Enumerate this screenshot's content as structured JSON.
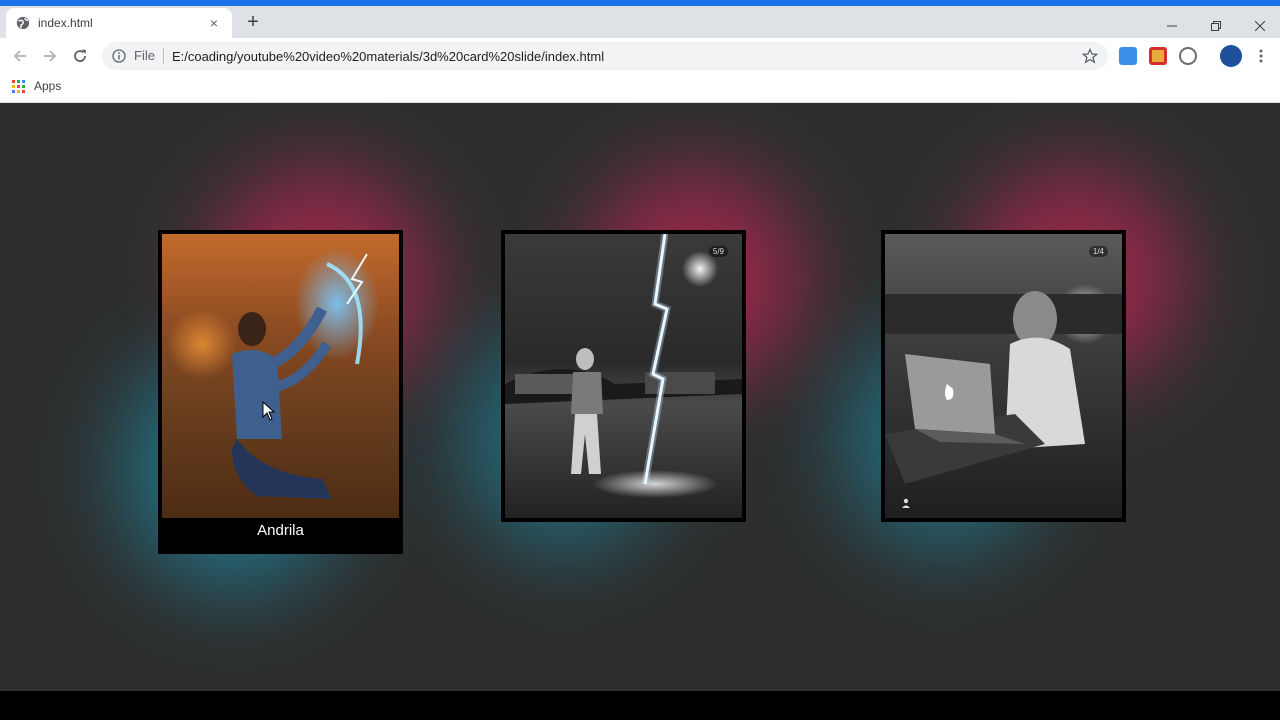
{
  "browser": {
    "tab_title": "index.html",
    "tab_close": "×",
    "new_tab": "+",
    "url_scheme": "File",
    "url": "E:/coading/youtube%20video%20materials/3d%20card%20slide/index.html",
    "bookmark_apps": "Apps",
    "accent": "#1a73e8"
  },
  "cards": [
    {
      "caption": "Andrila",
      "badge": ""
    },
    {
      "caption": "",
      "badge": "5/9"
    },
    {
      "caption": "",
      "badge": "1/4"
    }
  ],
  "colors": {
    "page_background": "#2d2f2e",
    "glow_pink": "#e0245e",
    "glow_cyan": "#1aa3c8"
  }
}
